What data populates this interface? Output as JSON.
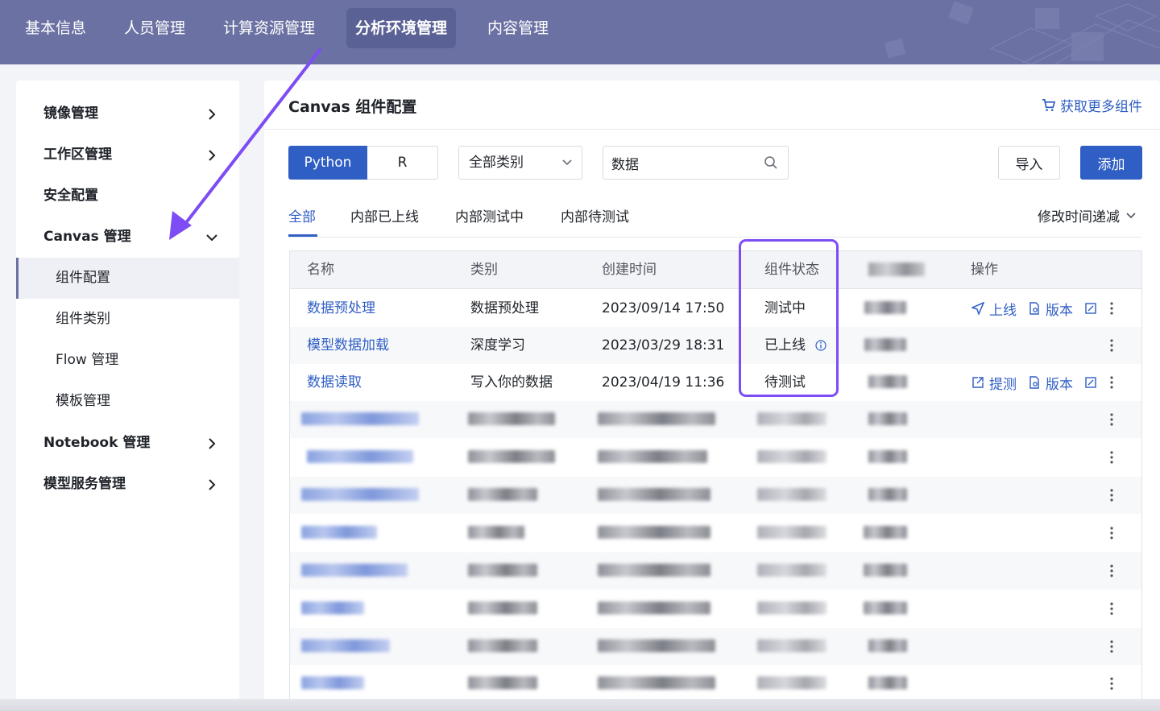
{
  "topnav": {
    "items": [
      "基本信息",
      "人员管理",
      "计算资源管理",
      "分析环境管理",
      "内容管理"
    ],
    "active_index": 3
  },
  "sidebar": {
    "groups": [
      {
        "label": "镜像管理",
        "expanded": false
      },
      {
        "label": "工作区管理",
        "expanded": false
      },
      {
        "label": "安全配置",
        "expanded": false
      },
      {
        "label": "Canvas 管理",
        "expanded": true
      },
      {
        "label": "Notebook 管理",
        "expanded": false
      },
      {
        "label": "模型服务管理",
        "expanded": false
      }
    ],
    "canvas_children": [
      "组件配置",
      "组件类别",
      "Flow 管理",
      "模板管理"
    ],
    "selected_child": "组件配置"
  },
  "main": {
    "title": "Canvas 组件配置",
    "more_link": "获取更多组件",
    "lang_toggle": [
      "Python",
      "R"
    ],
    "active_lang": "Python",
    "category_select": "全部类别",
    "search_value": "数据",
    "import_label": "导入",
    "add_label": "添加",
    "tabs": [
      "全部",
      "内部已上线",
      "内部测试中",
      "内部待测试"
    ],
    "active_tab": "全部",
    "sort_label": "修改时间递减"
  },
  "table": {
    "columns": [
      "名称",
      "类别",
      "创建时间",
      "组件状态",
      "",
      "操作"
    ],
    "rows": [
      {
        "name": "数据预处理",
        "category": "数据预处理",
        "created": "2023/09/14 17:50",
        "status": "测试中",
        "ops": [
          "上线",
          "版本"
        ]
      },
      {
        "name": "模型数据加载",
        "category": "深度学习",
        "created": "2023/03/29 18:31",
        "status": "已上线",
        "ops": []
      },
      {
        "name": "数据读取",
        "category": "写入你的数据",
        "created": "2023/04/19 11:36",
        "status": "待测试",
        "ops": [
          "提测",
          "版本"
        ]
      }
    ],
    "blurred_row_count": 8
  },
  "colors": {
    "nav_bg": "#6b72a3",
    "primary": "#2f5ec4",
    "highlight": "#7d4cf5"
  }
}
